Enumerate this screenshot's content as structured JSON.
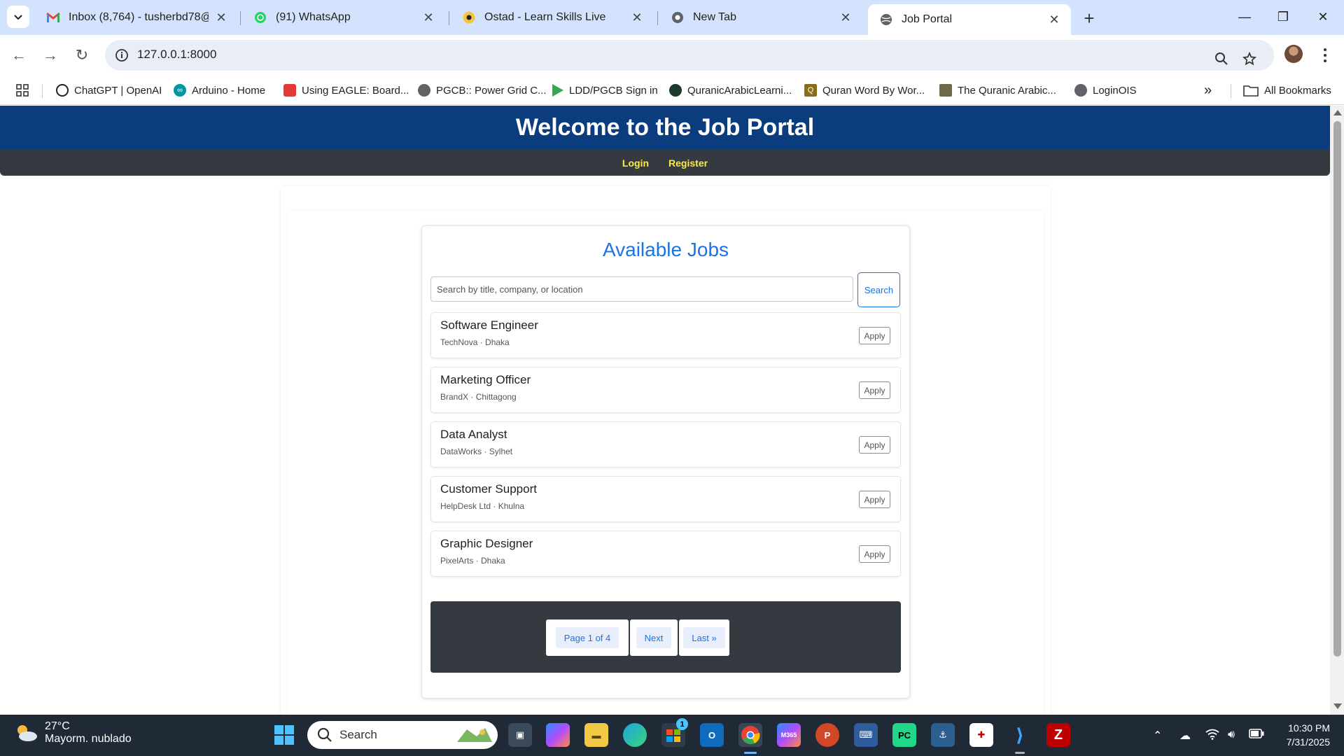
{
  "browser": {
    "tabs": [
      {
        "label": "Inbox (8,764) - tusherbd78@gm",
        "icon": "gmail-icon"
      },
      {
        "label": "(91) WhatsApp",
        "icon": "whatsapp-icon"
      },
      {
        "label": "Ostad - Learn Skills Live",
        "icon": "ostad-icon"
      },
      {
        "label": "New Tab",
        "icon": "chrome-icon"
      },
      {
        "label": "Job Portal",
        "icon": "globe-icon",
        "active": true
      }
    ],
    "url": "127.0.0.1:8000",
    "bookmarks": [
      {
        "label": "ChatGPT | OpenAI",
        "icon": "openai-icon"
      },
      {
        "label": "Arduino - Home",
        "icon": "arduino-icon"
      },
      {
        "label": "Using EAGLE: Board...",
        "icon": "eagle-icon"
      },
      {
        "label": "PGCB:: Power Grid C...",
        "icon": "globe-icon"
      },
      {
        "label": "LDD/PGCB Sign in",
        "icon": "play-icon"
      },
      {
        "label": "QuranicArabicLearni...",
        "icon": "circle-icon"
      },
      {
        "label": "Quran Word By Wor...",
        "icon": "q-icon"
      },
      {
        "label": "The Quranic Arabic...",
        "icon": "book-icon"
      },
      {
        "label": "LoginOIS",
        "icon": "globe-icon"
      }
    ],
    "all_bookmarks": "All Bookmarks",
    "overflow": "»"
  },
  "site": {
    "header_title": "Welcome to the Job Portal",
    "nav": {
      "login": "Login",
      "register": "Register"
    }
  },
  "jobs_section": {
    "title": "Available Jobs",
    "search_placeholder": "Search by title, company, or location",
    "search_button": "Search",
    "apply_label": "Apply",
    "jobs": [
      {
        "title": "Software Engineer",
        "meta": "TechNova · Dhaka"
      },
      {
        "title": "Marketing Officer",
        "meta": "BrandX · Chittagong"
      },
      {
        "title": "Data Analyst",
        "meta": "DataWorks · Sylhet"
      },
      {
        "title": "Customer Support",
        "meta": "HelpDesk Ltd · Khulna"
      },
      {
        "title": "Graphic Designer",
        "meta": "PixelArts · Dhaka"
      }
    ],
    "pagination": {
      "page_info": "Page 1 of 4",
      "next": "Next",
      "last": "Last »"
    }
  },
  "taskbar": {
    "weather_temp": "27°C",
    "weather_desc": "Mayorm. nublado",
    "search_label": "Search",
    "time": "10:30 PM",
    "date": "7/31/2025",
    "store_badge": "1"
  },
  "colors": {
    "header_bg": "#0b3d7e",
    "nav_bg": "#343a40",
    "nav_link": "#ffeb3b",
    "accent": "#1a73e8"
  }
}
